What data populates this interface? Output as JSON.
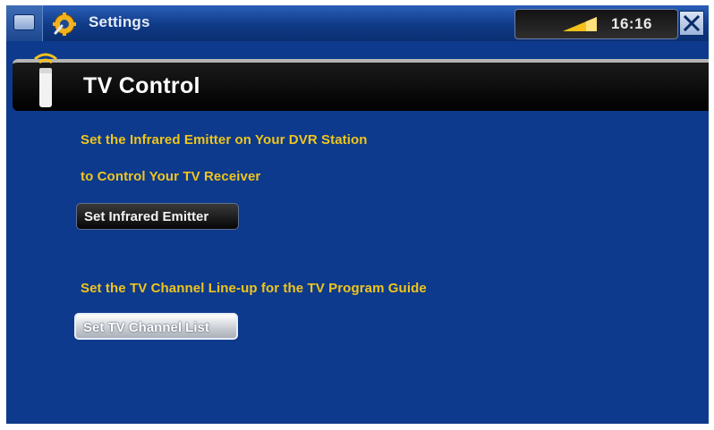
{
  "titlebar": {
    "app_title": "Settings",
    "clock": "16:16",
    "close_label": "Close",
    "icons": [
      "menu-tab-icon",
      "settings-gear-icon",
      "signal-strength-icon",
      "close-icon"
    ]
  },
  "section": {
    "title": "TV Control",
    "icon": "remote-control-icon"
  },
  "content": {
    "line1": "Set the Infrared Emitter on Your DVR Station",
    "line2": "to Control Your TV Receiver",
    "btn_emitter": "Set Infrared Emitter",
    "line3": "Set the TV Channel Line-up for the TV Program Guide",
    "btn_channels": "Set TV Channel List"
  },
  "colors": {
    "background": "#0d3a8c",
    "text_accent": "#f0c51c",
    "header_bg": "#000000"
  }
}
